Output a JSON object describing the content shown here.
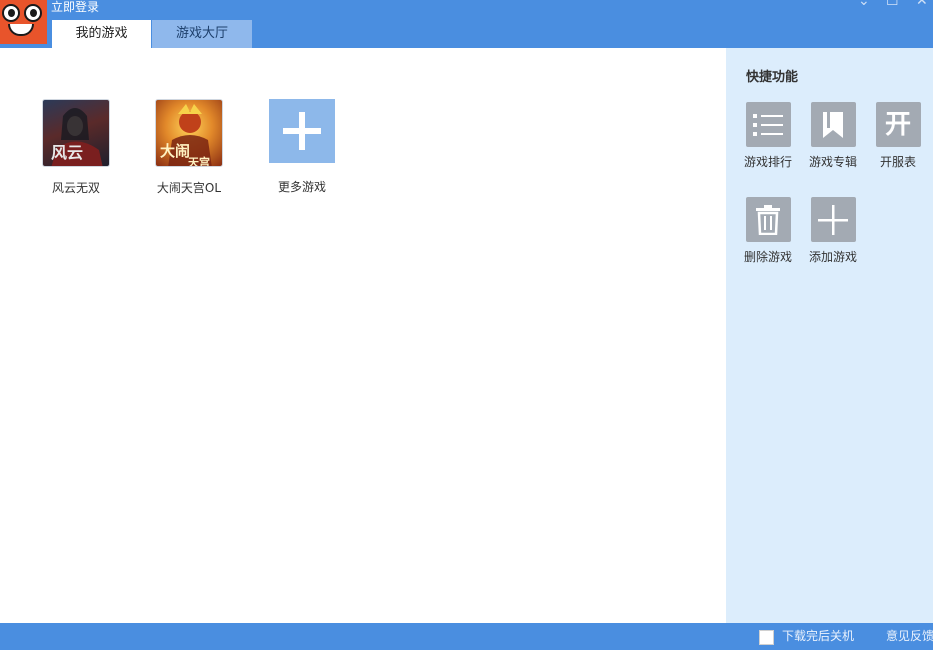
{
  "header": {
    "login_text": "立即登录",
    "controls": {
      "minimize": "⌄",
      "maximize": "☐",
      "close": "✕"
    }
  },
  "tabs": [
    {
      "label": "我的游戏",
      "active": true
    },
    {
      "label": "游戏大厅",
      "active": false
    }
  ],
  "games": [
    {
      "label": "风云无双",
      "icon": "game-fengyun-icon"
    },
    {
      "label": "大闹天宫OL",
      "icon": "game-danao-icon"
    },
    {
      "label": "更多游戏",
      "icon": "plus-icon"
    }
  ],
  "quick": {
    "title": "快捷功能",
    "items": [
      {
        "label": "游戏排行",
        "icon": "list-icon"
      },
      {
        "label": "游戏专辑",
        "icon": "bookmark-icon"
      },
      {
        "label": "开服表",
        "icon": "server-open-icon",
        "glyph": "开"
      },
      {
        "label": "删除游戏",
        "icon": "trash-icon"
      },
      {
        "label": "添加游戏",
        "icon": "plus-icon"
      }
    ]
  },
  "footer": {
    "shutdown_label": "下载完后关机",
    "feedback_label": "意见反馈"
  },
  "colors": {
    "accent": "#4a8ee0",
    "panel_bg": "#dcedfc",
    "icon_gray": "#a3aab3",
    "add_tile": "#8db8ea",
    "logo_orange": "#e8542b"
  }
}
